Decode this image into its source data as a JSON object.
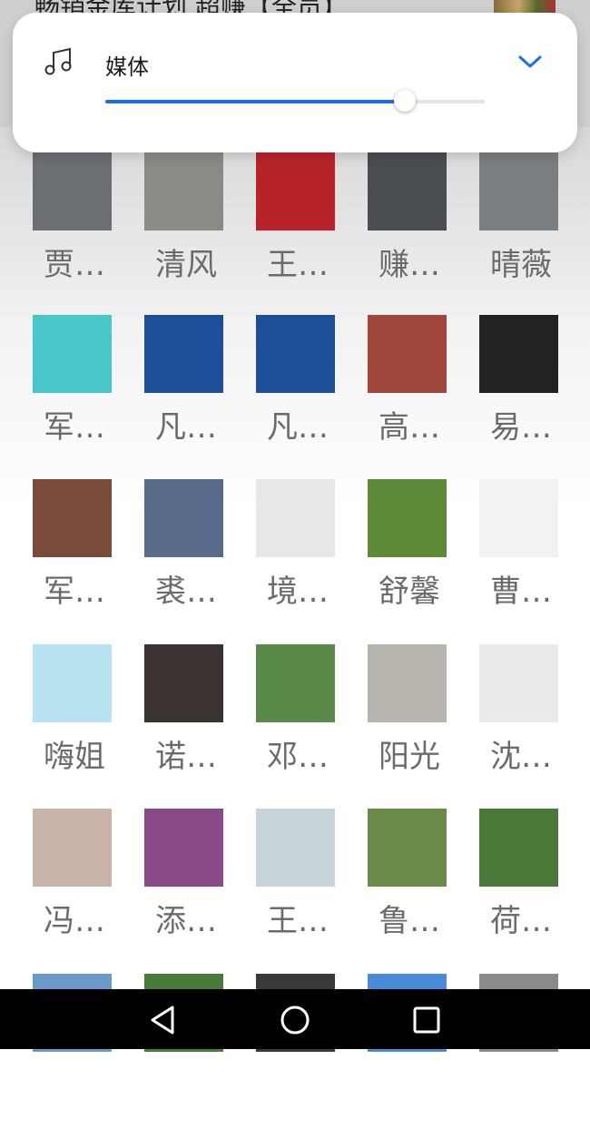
{
  "header": {
    "title_partial": "畅销金库计划 超赚【全员】"
  },
  "volume_panel": {
    "label": "媒体",
    "icon": "music-note-icon",
    "expand_icon": "chevron-down-icon",
    "level_fraction": 0.79,
    "accent_color": "#1c6ee0"
  },
  "members": [
    {
      "name": "贾…",
      "color": "#6b6e73"
    },
    {
      "name": "清风",
      "color": "#8c8a84"
    },
    {
      "name": "王…",
      "color": "#b8232a"
    },
    {
      "name": "赚…",
      "color": "#4a4d52"
    },
    {
      "name": "晴薇",
      "color": "#7a7d82"
    },
    {
      "name": "军…",
      "color": "#49c6c8"
    },
    {
      "name": "凡…",
      "color": "#1c4e9a"
    },
    {
      "name": "凡…",
      "color": "#1c4e9a"
    },
    {
      "name": "高…",
      "color": "#a0463a"
    },
    {
      "name": "易…",
      "color": "#222222"
    },
    {
      "name": "军…",
      "color": "#7a4a3a"
    },
    {
      "name": "裘…",
      "color": "#5a6a8a"
    },
    {
      "name": "境…",
      "color": "#e8e8e8"
    },
    {
      "name": "舒馨",
      "color": "#5f8a3a"
    },
    {
      "name": "曹…",
      "color": "#f2f2f2"
    },
    {
      "name": "嗨姐",
      "color": "#b8e4f2"
    },
    {
      "name": "诺…",
      "color": "#3a3332"
    },
    {
      "name": "邓…",
      "color": "#5a8a4a"
    },
    {
      "name": "阳光",
      "color": "#b8b4ae"
    },
    {
      "name": "沈…",
      "color": "#eaeaea"
    },
    {
      "name": "冯…",
      "color": "#c8b4a8"
    },
    {
      "name": "添…",
      "color": "#8a4a8a"
    },
    {
      "name": "王…",
      "color": "#c8d4d8"
    },
    {
      "name": "鲁…",
      "color": "#6a8a4a"
    },
    {
      "name": "荷…",
      "color": "#4a7a3a"
    },
    {
      "name": "",
      "color": "#6a9ac8"
    },
    {
      "name": "",
      "color": "#4a7a3a"
    },
    {
      "name": "",
      "color": "#3a3a3a"
    },
    {
      "name": "",
      "color": "#4a8ad8"
    },
    {
      "name": "",
      "color": "#8a8a8a"
    }
  ],
  "navbar": {
    "back_icon": "back-triangle-icon",
    "home_icon": "home-circle-icon",
    "recents_icon": "recents-square-icon"
  }
}
